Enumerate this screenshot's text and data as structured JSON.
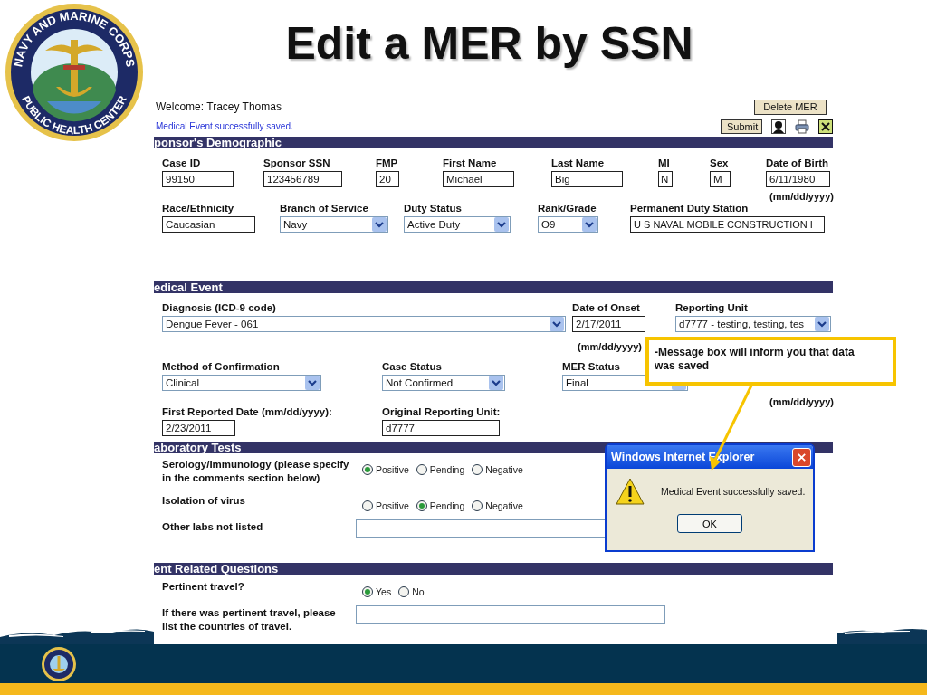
{
  "slide": {
    "title": "Edit a MER by SSN",
    "logo": {
      "top_text": "NAVY AND MARINE CORPS",
      "bottom_text": "PUBLIC HEALTH CENTER"
    }
  },
  "app": {
    "welcome": "Welcome: Tracey Thomas",
    "status_message": "Medical Event successfully saved.",
    "delete_button": "Delete MER",
    "submit_button": "Submit",
    "sections": [
      {
        "title": "ponsor's Demographic",
        "kind": "grid",
        "rows": [
          {
            "fields": [
              {
                "label": "Case ID",
                "kind": "input",
                "value": "99150"
              },
              {
                "label": "Sponsor SSN",
                "kind": "input",
                "value": "123456789"
              },
              {
                "label": "FMP",
                "kind": "input",
                "value": "20"
              },
              {
                "label": "First Name",
                "kind": "input",
                "value": "Michael"
              },
              {
                "label": "Last Name",
                "kind": "input",
                "value": "Big"
              },
              {
                "label": "MI",
                "kind": "input",
                "value": "N"
              },
              {
                "label": "Sex",
                "kind": "input",
                "value": "M"
              },
              {
                "label": "Date of Birth",
                "kind": "input",
                "value": "6/11/1980"
              }
            ],
            "hint": "(mm/dd/yyyy)"
          },
          {
            "fields": [
              {
                "label": "Race/Ethnicity",
                "kind": "input",
                "value": "Caucasian"
              },
              {
                "label": "Branch of Service",
                "kind": "select",
                "value": "Navy"
              },
              {
                "label": "Duty Status",
                "kind": "select",
                "value": "Active Duty"
              },
              {
                "label": "Rank/Grade",
                "kind": "select",
                "value": "O9"
              },
              {
                "label": "Permanent Duty Station",
                "kind": "input",
                "value": "U S NAVAL MOBILE CONSTRUCTION I"
              }
            ]
          }
        ]
      },
      {
        "title": "edical Event",
        "kind": "grid",
        "rows": [
          {
            "fields": [
              {
                "label": "Diagnosis (ICD-9 code)",
                "kind": "select",
                "value": "Dengue Fever - 061"
              },
              {
                "label": "Date of Onset",
                "kind": "input",
                "value": "2/17/2011"
              },
              {
                "label": "Reporting Unit",
                "kind": "select",
                "value": "d7777 - testing, testing, tes"
              }
            ],
            "hint": "(mm/dd/yyyy)"
          },
          {
            "fields": [
              {
                "label": "Method of Confirmation",
                "kind": "select",
                "value": "Clinical"
              },
              {
                "label": "Case Status",
                "kind": "select",
                "value": "Not Confirmed"
              },
              {
                "label": "MER Status",
                "kind": "select",
                "value": "Final"
              }
            ],
            "hint": "(mm/dd/yyyy)"
          },
          {
            "fields": [
              {
                "label": "First Reported Date (mm/dd/yyyy):",
                "kind": "input",
                "value": "2/23/2011"
              },
              {
                "label": "Original Reporting Unit:",
                "kind": "input",
                "value": "d7777"
              }
            ]
          }
        ]
      },
      {
        "title": "aboratory Tests",
        "kind": "questions",
        "rows": [
          {
            "label": "Serology/Immunology (please specify\nin the comments section below)",
            "kind": "radio",
            "options": [
              {
                "label": "Positive",
                "selected": true
              },
              {
                "label": "Pending",
                "selected": false
              },
              {
                "label": "Negative",
                "selected": false
              }
            ]
          },
          {
            "label": "Isolation of virus",
            "kind": "radio",
            "options": [
              {
                "label": "Positive",
                "selected": false
              },
              {
                "label": "Pending",
                "selected": true
              },
              {
                "label": "Negative",
                "selected": false
              }
            ]
          },
          {
            "label": "Other labs not listed",
            "kind": "input"
          }
        ]
      },
      {
        "title": "ent Related Questions",
        "kind": "questions",
        "rows": [
          {
            "label": "Pertinent travel?",
            "kind": "radio",
            "options": [
              {
                "label": "Yes",
                "selected": true
              },
              {
                "label": "No",
                "selected": false
              }
            ]
          },
          {
            "label": "If there was pertinent travel, please\nlist the countries of travel.",
            "kind": "input"
          }
        ]
      }
    ]
  },
  "callout": {
    "text": "-Message box will inform you that data was saved"
  },
  "dialog": {
    "title": "Windows Internet Explorer",
    "message": "Medical Event successfully saved.",
    "button": "OK"
  }
}
